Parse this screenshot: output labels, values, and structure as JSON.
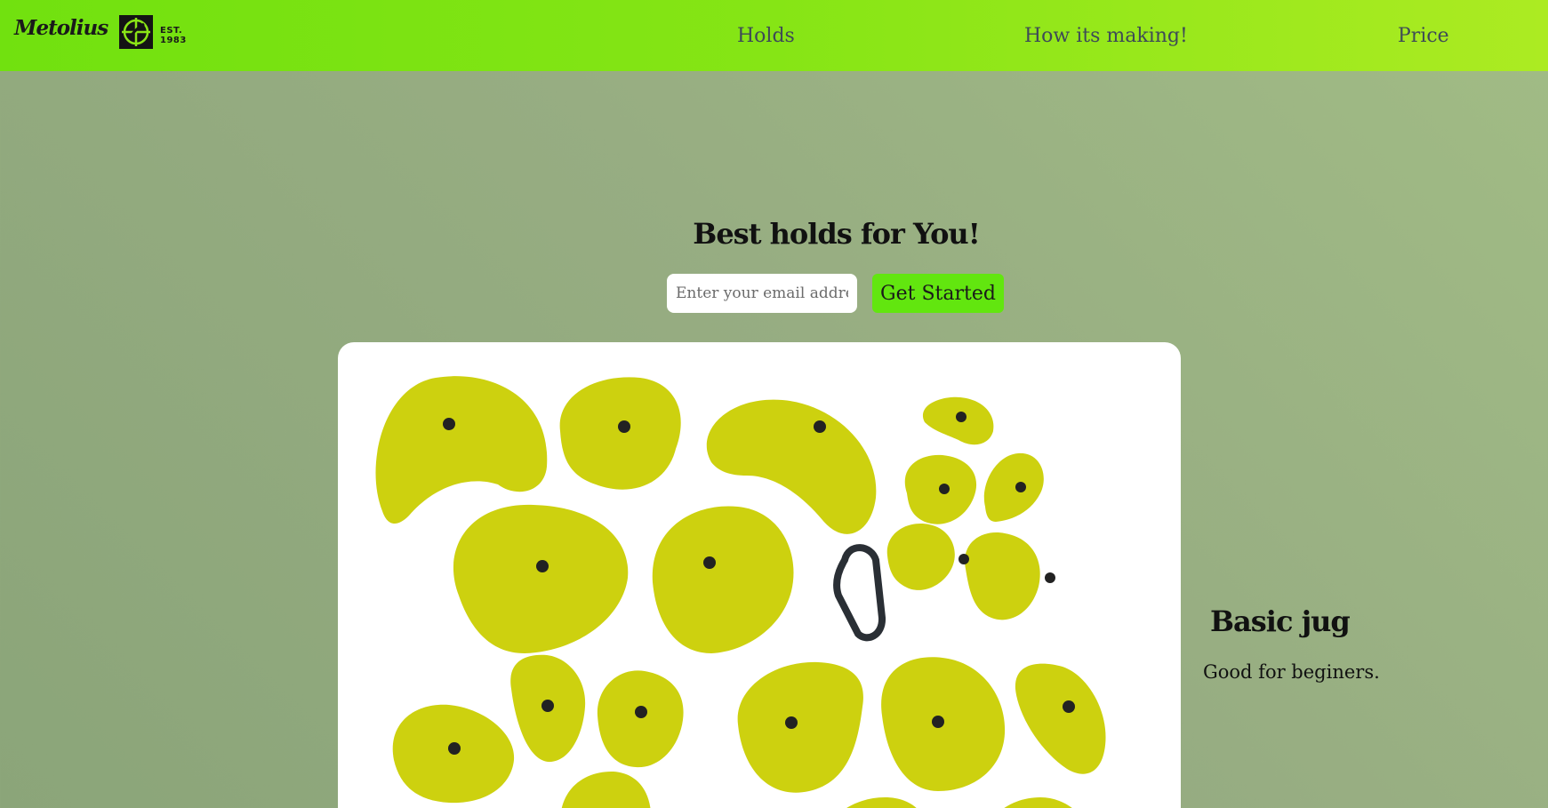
{
  "brand": {
    "name": "Metolius",
    "established": "EST. 1983"
  },
  "nav": {
    "items": [
      {
        "label": "Holds"
      },
      {
        "label": "How its making!"
      },
      {
        "label": "Price"
      }
    ]
  },
  "hero": {
    "title": "Best holds for You!",
    "email_placeholder": "Enter your email address",
    "cta_label": "Get Started"
  },
  "product": {
    "image_icon": "climbing-holds-photo",
    "name": "Basic jug",
    "description": "Good for beginers."
  },
  "colors": {
    "nav_gradient_start": "#71e10f",
    "nav_gradient_end": "#aceb22",
    "page_background": "#97ad82",
    "cta_background": "#62e60f",
    "hold_color": "#cdd10f",
    "nav_text": "#3e4a57"
  }
}
